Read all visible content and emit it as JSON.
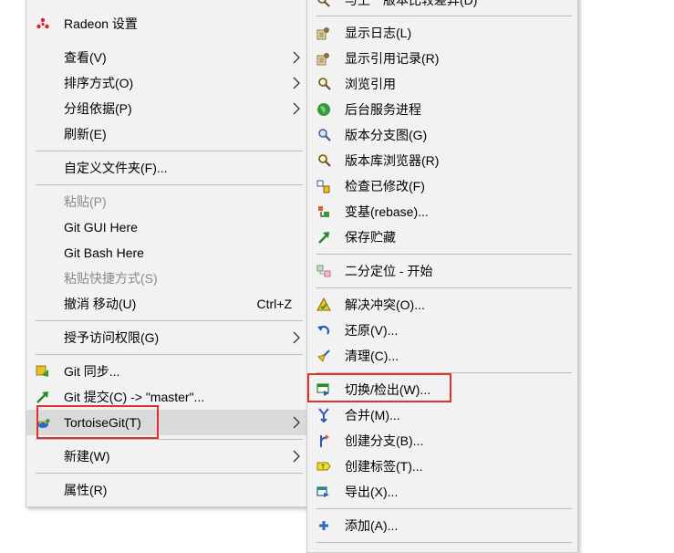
{
  "main_menu": {
    "radeon": "Radeon 设置",
    "view": "查看(V)",
    "sort": "排序方式(O)",
    "group": "分组依据(P)",
    "refresh": "刷新(E)",
    "customize": "自定义文件夹(F)...",
    "paste": "粘贴(P)",
    "git_gui": "Git GUI Here",
    "git_bash": "Git Bash Here",
    "paste_shortcut": "粘贴快捷方式(S)",
    "undo_move": "撤消 移动(U)",
    "undo_shortcut": "Ctrl+Z",
    "grant_access": "授予访问权限(G)",
    "git_sync": "Git 同步...",
    "git_commit": "Git 提交(C) -> \"master\"...",
    "tortoisegit": "TortoiseGit(T)",
    "new": "新建(W)",
    "properties": "属性(R)"
  },
  "sub_menu": {
    "diff_cut": "与上一版本比较差异(D)",
    "show_log": "显示日志(L)",
    "show_reflog": "显示引用记录(R)",
    "browse_refs": "浏览引用",
    "daemon": "后台服务进程",
    "revision_graph": "版本分支图(G)",
    "repo_browser": "版本库浏览器(R)",
    "check_modifications": "检查已修改(F)",
    "rebase": "变基(rebase)...",
    "stash": "保存贮藏",
    "bisect": "二分定位 - 开始",
    "resolve": "解决冲突(O)...",
    "revert": "还原(V)...",
    "cleanup": "清理(C)...",
    "switch_checkout": "切换/检出(W)...",
    "merge": "合并(M)...",
    "create_branch": "创建分支(B)...",
    "create_tag": "创建标签(T)...",
    "export": "导出(X)...",
    "add": "添加(A)..."
  },
  "colors": {
    "menu_bg": "#f2f2f2",
    "highlight": "#dadada",
    "annotation_box": "#e0302e",
    "radeon_red": "#d8232a"
  }
}
